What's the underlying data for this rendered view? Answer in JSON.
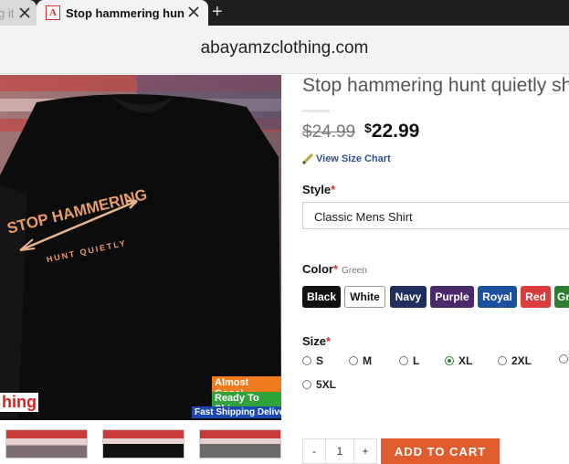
{
  "browser": {
    "tabs": [
      {
        "label": "g it",
        "active": false
      },
      {
        "label": "Stop hammering hunt qu",
        "active": true
      }
    ],
    "favicon_letter": "A",
    "url": "abayamzclothing.com"
  },
  "product": {
    "title": "Stop hammering hunt quietly sh",
    "price_old": "$24.99",
    "price_new": "22.99",
    "price_currency": "$",
    "size_chart_label": "View Size Chart",
    "style_label": "Style",
    "style_value": "Classic Mens Shirt",
    "color_label": "Color",
    "color_selected": "Green",
    "colors": [
      {
        "label": "Black",
        "bg": "#111111",
        "fg": "#ffffff"
      },
      {
        "label": "White",
        "bg": "#ffffff",
        "fg": "#111111"
      },
      {
        "label": "Navy",
        "bg": "#1f2e5c",
        "fg": "#ffffff"
      },
      {
        "label": "Purple",
        "bg": "#4a2a6b",
        "fg": "#ffffff"
      },
      {
        "label": "Royal",
        "bg": "#1d4fa0",
        "fg": "#ffffff"
      },
      {
        "label": "Red",
        "bg": "#d93d3d",
        "fg": "#ffffff"
      },
      {
        "label": "Gr",
        "bg": "#2f7d32",
        "fg": "#ffffff"
      }
    ],
    "size_label": "Size",
    "sizes": [
      "S",
      "M",
      "L",
      "XL",
      "2XL",
      "",
      "5XL"
    ],
    "size_selected": "XL",
    "quantity": "1",
    "qty_minus": "-",
    "qty_plus": "+",
    "add_to_cart": "ADD TO CART"
  },
  "image": {
    "shirt_text_1": "STOP HAMMERING",
    "shirt_text_2": "HUNT QUIETLY",
    "badges": [
      {
        "label": "Almost Gone!",
        "bg": "#f07b1d"
      },
      {
        "label": "Ready To Ship",
        "bg": "#2fa33a"
      },
      {
        "label": "Fast Shipping Delivery",
        "bg": "#1c49b0"
      }
    ],
    "corner_text": "hing"
  }
}
